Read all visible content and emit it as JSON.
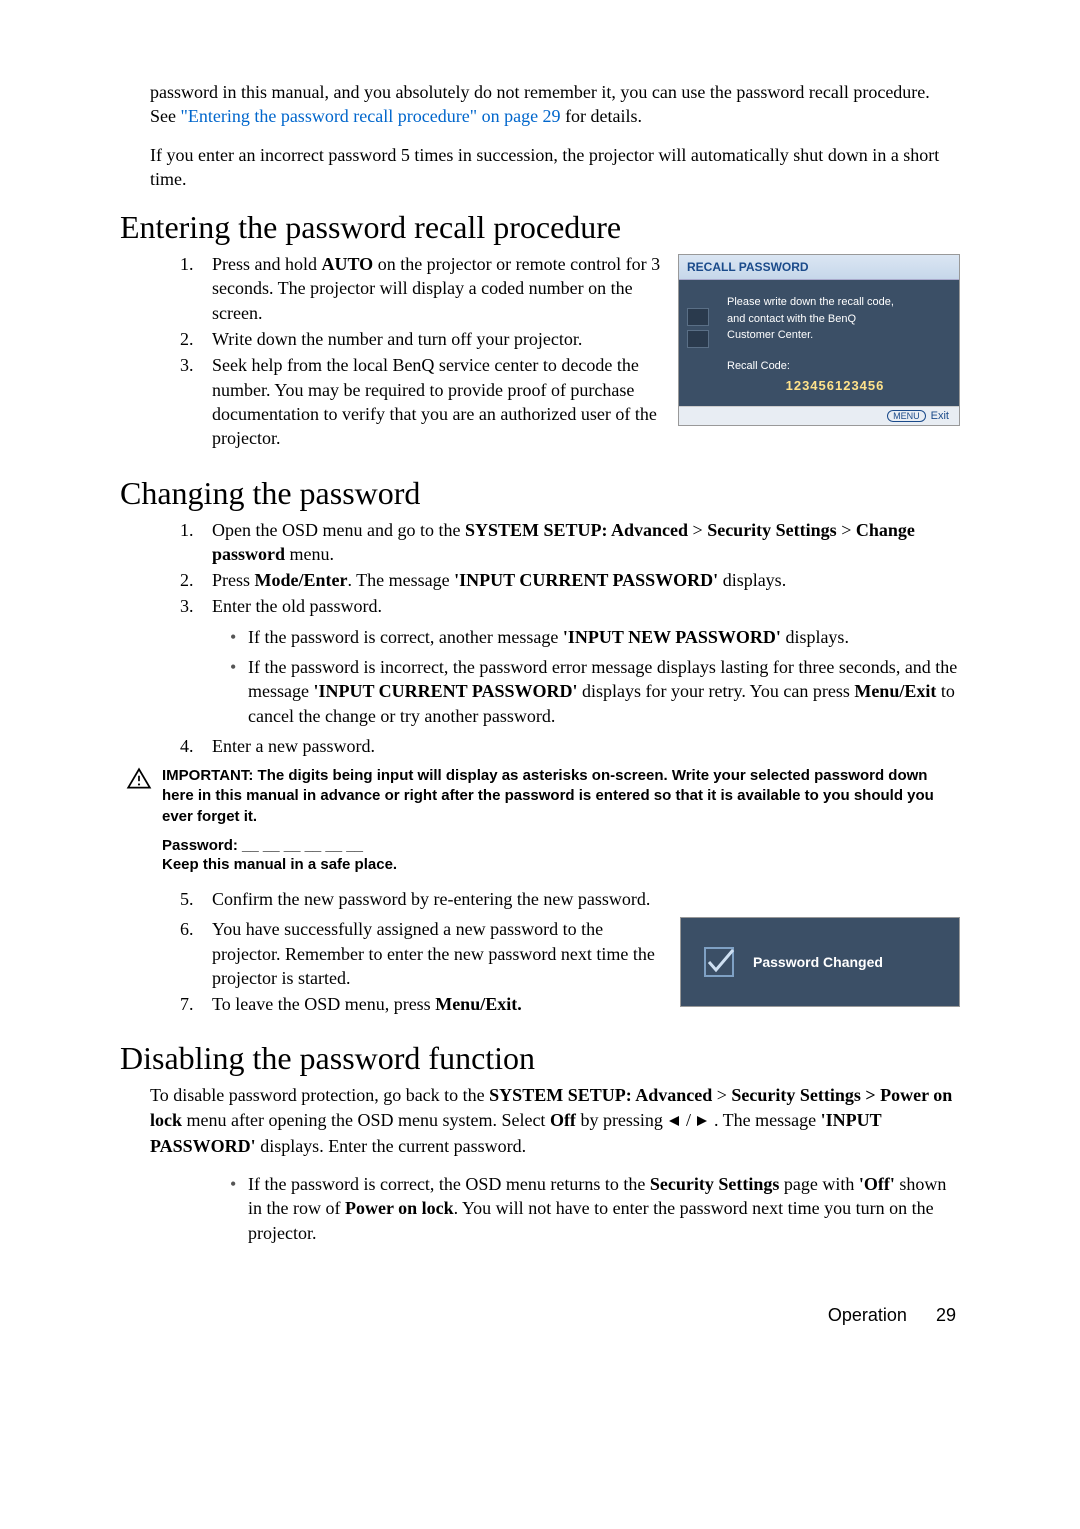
{
  "intro": {
    "p1_a": "password in this manual, and you absolutely do not remember it, you can use the password recall procedure. See ",
    "p1_link": "\"Entering the password recall procedure\" on page 29",
    "p1_b": " for details.",
    "p2": "If you enter an incorrect password 5 times in succession, the projector will automatically shut down in a short time."
  },
  "section1": {
    "heading": "Entering the password recall procedure",
    "li1_a": "Press and hold ",
    "li1_bold": "AUTO",
    "li1_b": " on the projector or remote control for 3 seconds. The projector will display a coded number on the screen.",
    "li2": "Write down the number and turn off your projector.",
    "li3": "Seek help from the local BenQ service center to decode the number. You may be required to provide proof of purchase documentation to verify that you are an authorized user of the projector."
  },
  "recall_dialog": {
    "title": "RECALL PASSWORD",
    "msg1": "Please write down the recall code,",
    "msg2": "and contact with the BenQ",
    "msg3": "Customer Center.",
    "code_label": "Recall Code:",
    "code": "123456123456",
    "footer_btn": "MENU",
    "footer_exit": "Exit"
  },
  "section2": {
    "heading": "Changing the password",
    "li1_a": "Open the OSD menu and go to the ",
    "li1_b1": "SYSTEM SETUP: Advanced",
    "li1_gt1": " > ",
    "li1_b2": "Security Settings",
    "li1_gt2": " > ",
    "li1_b3": "Change password",
    "li1_c": " menu.",
    "li2_a": "Press ",
    "li2_b1": "Mode/Enter",
    "li2_b": ". The message ",
    "li2_b2": "'INPUT CURRENT PASSWORD'",
    "li2_c": " displays.",
    "li3": "Enter the old password.",
    "bul1_a": "If the password is correct, another message ",
    "bul1_b": "'INPUT NEW PASSWORD'",
    "bul1_c": " displays.",
    "bul2_a": "If the password is incorrect, the password error message displays lasting for three seconds, and the message ",
    "bul2_b": "'INPUT CURRENT PASSWORD'",
    "bul2_c": " displays for your retry. You can press ",
    "bul2_d": "Menu/Exit",
    "bul2_e": " to cancel the change or try another password.",
    "li4": "Enter a new password.",
    "important": "IMPORTANT: The digits being input will display as asterisks on-screen. Write your selected password down here in this manual in advance or right after the password is entered so that it is available to you should you ever forget it.",
    "pw_line": "Password: __ __ __ __ __ __",
    "keep_line": "Keep this manual in a safe place.",
    "li5": "Confirm the new password by re-entering the new password.",
    "li6": "You have successfully assigned a new password to the projector. Remember to enter the new password next time the projector is started.",
    "li7_a": "To leave the OSD menu, press ",
    "li7_b": "Menu/Exit."
  },
  "confirm_dialog": {
    "text": "Password Changed"
  },
  "section3": {
    "heading": "Disabling the password function",
    "p1_a": "To disable password protection, go back to the ",
    "p1_b1": "SYSTEM SETUP: Advanced",
    "p1_gt1": " > ",
    "p1_b2": "Security Settings > Power on lock",
    "p1_b": " menu after opening the OSD menu system. Select ",
    "p1_b3": "Off",
    "p1_c": " by pressing ",
    "p1_d": "The message ",
    "p1_b4": "'INPUT PASSWORD'",
    "p1_e": " displays. Enter the current password.",
    "bul1_a": "If the password is correct, the OSD menu returns to the ",
    "bul1_b1": "Security Settings",
    "bul1_b": " page with ",
    "bul1_b2": "'Off'",
    "bul1_c": " shown in the row of ",
    "bul1_b3": "Power on lock",
    "bul1_d": ". You will not have to enter the password next time you turn on the projector."
  },
  "footer": {
    "label": "Operation",
    "page": "29"
  }
}
